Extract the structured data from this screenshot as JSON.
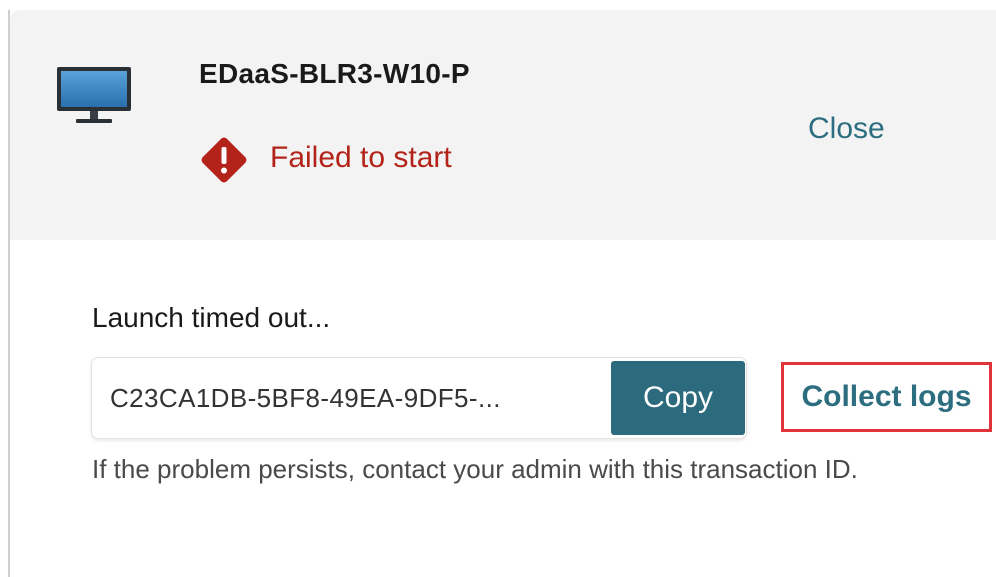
{
  "header": {
    "device_name": "EDaaS-BLR3-W10-P",
    "device_icon": "monitor-icon",
    "status": {
      "text": "Failed to start",
      "icon": "error-diamond-icon",
      "color": "#b3231a"
    },
    "close_label": "Close"
  },
  "body": {
    "message": "Launch timed out...",
    "transaction_id": "C23CA1DB-5BF8-49EA-9DF5-...",
    "copy_label": "Copy",
    "collect_logs_label": "Collect logs",
    "help_text": "If the problem persists, contact your admin with this transaction ID."
  },
  "colors": {
    "accent": "#2b6b7d",
    "link": "#2c6e7f",
    "error": "#b3231a",
    "highlight_border": "#e0343a",
    "header_bg": "#f3f3f3"
  }
}
